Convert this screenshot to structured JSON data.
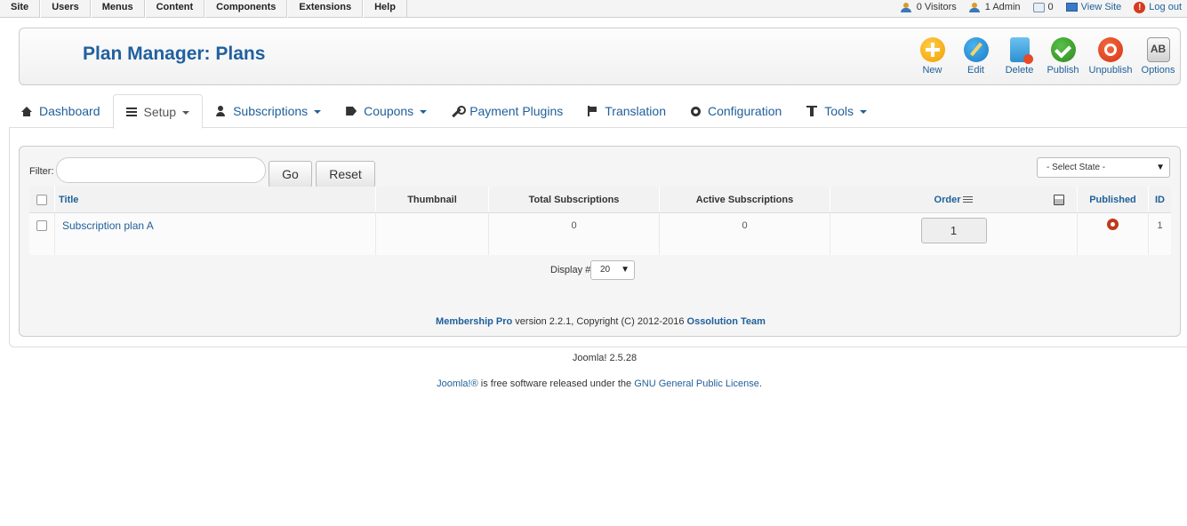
{
  "top_menu": [
    "Site",
    "Users",
    "Menus",
    "Content",
    "Components",
    "Extensions",
    "Help"
  ],
  "status": {
    "visitors": "0 Visitors",
    "admins": "1 Admin",
    "messages": "0",
    "view_site": "View Site",
    "logout": "Log out"
  },
  "header": {
    "title": "Plan Manager: Plans"
  },
  "toolbar": {
    "new": "New",
    "edit": "Edit",
    "delete": "Delete",
    "publish": "Publish",
    "unpublish": "Unpublish",
    "options": "Options",
    "options_glyph": "AB"
  },
  "tabs": {
    "dashboard": "Dashboard",
    "setup": "Setup",
    "subscriptions": "Subscriptions",
    "coupons": "Coupons",
    "payment_plugins": "Payment Plugins",
    "translation": "Translation",
    "configuration": "Configuration",
    "tools": "Tools"
  },
  "filter": {
    "label": "Filter:",
    "value": "",
    "go": "Go",
    "reset": "Reset",
    "state_select": "- Select State -"
  },
  "table": {
    "headers": {
      "title": "Title",
      "thumbnail": "Thumbnail",
      "total": "Total Subscriptions",
      "active": "Active Subscriptions",
      "order": "Order",
      "published": "Published",
      "id": "ID"
    },
    "rows": [
      {
        "title": "Subscription plan A",
        "thumbnail": "",
        "total": "0",
        "active": "0",
        "order": "1",
        "published": true,
        "id": "1"
      }
    ]
  },
  "pagination": {
    "label": "Display #",
    "value": "20"
  },
  "credits": {
    "product": "Membership Pro",
    "middle": " version 2.2.1, Copyright (C) 2012-2016 ",
    "team": "Ossolution Team"
  },
  "footer": {
    "version": "Joomla! 2.5.28",
    "joomla_link": "Joomla!®",
    "text": " is free software released under the ",
    "license_link": "GNU General Public License",
    "end": "."
  },
  "colors": {
    "link": "#1f5f99",
    "title": "#21609e"
  }
}
